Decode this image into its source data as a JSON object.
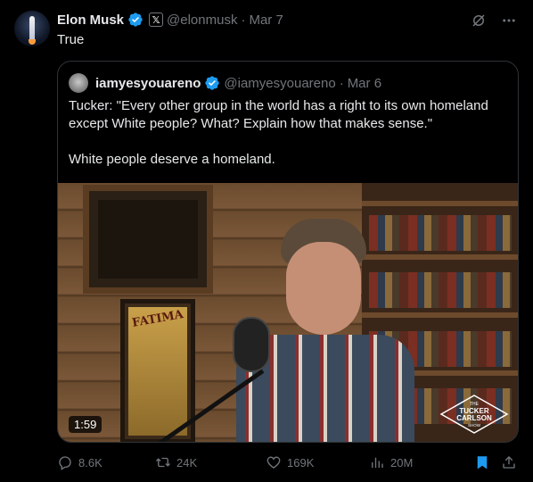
{
  "tweet": {
    "author_name": "Elon Musk",
    "handle": "@elonmusk",
    "separator": "·",
    "date": "Mar 7",
    "text": "True"
  },
  "quoted": {
    "author_name": "iamyesyouareno",
    "handle": "@iamyesyouareno",
    "separator": "·",
    "date": "Mar 6",
    "paragraph1": "Tucker: \"Every other group in the world has a right to its own homeland except White people? What? Explain how that makes sense.\"",
    "paragraph2": "White people deserve a homeland.",
    "video": {
      "duration": "1:59",
      "poster_text": "FATIMA",
      "logo_lines": [
        "THE",
        "TUCKER",
        "CARLSON",
        "SHOW"
      ]
    }
  },
  "actions": {
    "replies": "8.6K",
    "reposts": "24K",
    "likes": "169K",
    "views": "20M"
  },
  "colors": {
    "background": "#000000",
    "text": "#e7e9ea",
    "muted": "#71767b",
    "border": "#2f3336",
    "verified": "#1d9bf0",
    "bookmark": "#1d9bf0"
  },
  "icons": {
    "verified": "verified-badge-icon",
    "x_badge": "x-logo-icon",
    "grok": "grok-icon",
    "more": "more-icon",
    "reply": "reply-icon",
    "repost": "repost-icon",
    "like": "heart-icon",
    "views": "views-icon",
    "bookmark": "bookmark-icon",
    "share": "share-icon"
  }
}
